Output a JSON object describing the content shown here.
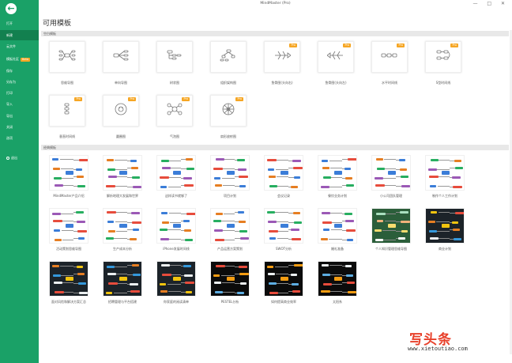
{
  "window": {
    "title": "MindMaster (Pro)",
    "controls": "— □ ✕"
  },
  "sidebar": {
    "back_icon": "arrow-left-icon",
    "items": [
      {
        "label": "打开"
      },
      {
        "label": "新建",
        "active": true
      },
      {
        "label": "云文件"
      },
      {
        "label": "模板社区",
        "badge": "Beta"
      },
      {
        "label": "保存"
      },
      {
        "label": "另存为"
      },
      {
        "label": "打印"
      },
      {
        "label": "导入"
      },
      {
        "label": "导出"
      },
      {
        "label": "关闭"
      },
      {
        "label": "选项"
      },
      {
        "label": "退出"
      }
    ]
  },
  "main": {
    "title": "可用模板",
    "blank_section": "空白模板",
    "classic_section": "经典模板",
    "pro_badge": "Pro",
    "blank_templates": [
      {
        "label": "思维导图",
        "icon": "mindmap-icon"
      },
      {
        "label": "单向导图",
        "icon": "right-map-icon",
        "pro": false
      },
      {
        "label": "树状图",
        "icon": "tree-icon"
      },
      {
        "label": "组织架构图",
        "icon": "org-chart-icon"
      },
      {
        "label": "鱼骨图(头向右)",
        "icon": "fishbone-right-icon",
        "pro": true
      },
      {
        "label": "鱼骨图(头向左)",
        "icon": "fishbone-left-icon",
        "pro": true
      },
      {
        "label": "水平时间线",
        "icon": "timeline-horizontal-icon",
        "pro": true
      },
      {
        "label": "S型时间线",
        "icon": "timeline-s-icon",
        "pro": true
      },
      {
        "label": "垂直时间线",
        "icon": "timeline-vertical-icon",
        "pro": true
      },
      {
        "label": "圆圈图",
        "icon": "circle-map-icon",
        "pro": true
      },
      {
        "label": "气泡图",
        "icon": "bubble-map-icon",
        "pro": true
      },
      {
        "label": "扇形放射图",
        "icon": "sector-radial-icon",
        "pro": true
      }
    ],
    "classic_templates": [
      {
        "label": "MindMaster产品介绍",
        "style": "light"
      },
      {
        "label": "解析地理大发展和世界",
        "style": "light"
      },
      {
        "label": "这样读书就够了",
        "style": "light"
      },
      {
        "label": "项目计划",
        "style": "light"
      },
      {
        "label": "会议记录",
        "style": "light"
      },
      {
        "label": "餐饮业务计划",
        "style": "light"
      },
      {
        "label": "小公司团队管理",
        "style": "light"
      },
      {
        "label": "制作个人工作计划",
        "style": "light"
      },
      {
        "label": "活动策划思维导图",
        "style": "light"
      },
      {
        "label": "生产成本分析",
        "style": "light"
      },
      {
        "label": "iPhone发展时间线",
        "style": "light"
      },
      {
        "label": "产品运营方案策划",
        "style": "light"
      },
      {
        "label": "SWOT分析",
        "style": "light"
      },
      {
        "label": "婚礼准备",
        "style": "light"
      },
      {
        "label": "个人知识管理思维导图",
        "style": "green"
      },
      {
        "label": "商业计划",
        "style": "dark"
      },
      {
        "label": "面对风险和解决方案汇总",
        "style": "dark"
      },
      {
        "label": "招聘管理与平台搭建",
        "style": "dark"
      },
      {
        "label": "你家庭的阅读清单",
        "style": "dark"
      },
      {
        "label": "PESTEL分析",
        "style": "black"
      },
      {
        "label": "如何提高商业效率",
        "style": "black"
      },
      {
        "label": "太阳系",
        "style": "black"
      }
    ]
  },
  "watermark": {
    "logo": "写头条",
    "url": "www.xietoutiao.com"
  }
}
